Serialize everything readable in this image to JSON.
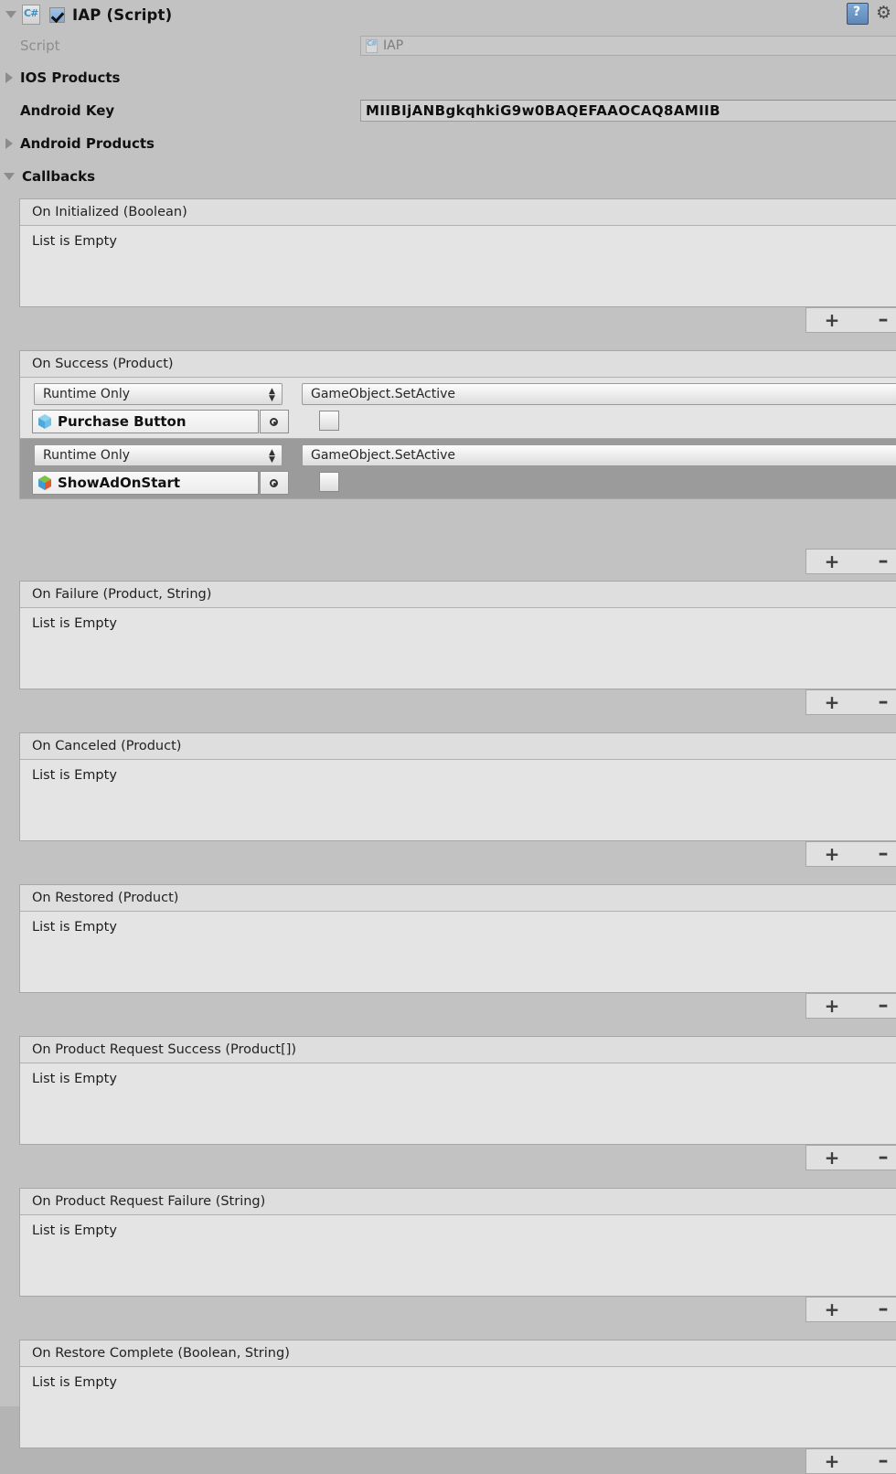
{
  "component": {
    "title": "IAP (Script)",
    "enabled_checkbox": true,
    "foldout_expanded": true,
    "script_icon": "csharp-script-icon",
    "help_icon": "help-book-icon",
    "gear_icon": "gear-icon"
  },
  "properties": [
    {
      "label": "Script",
      "type": "object_field",
      "value": "IAP",
      "disabled": true,
      "icon": "csharp-script-icon"
    },
    {
      "label": "IOS Products",
      "type": "foldout",
      "expanded": false
    },
    {
      "label": "Android Key",
      "type": "text_field",
      "value": "MIIBIjANBgkqhkiG9w0BAQEFAAOCAQ8AMIIB"
    },
    {
      "label": "Android Products",
      "type": "foldout",
      "expanded": false
    },
    {
      "label": "Callbacks",
      "type": "foldout",
      "expanded": true
    }
  ],
  "callbacks": [
    {
      "title": "On Initialized (Boolean)",
      "empty_text": "List is Empty",
      "entries": []
    },
    {
      "title": "On Success (Product)",
      "empty_text": "List is Empty",
      "entries": [
        {
          "mode": "Runtime Only",
          "function": "GameObject.SetActive",
          "target": "Purchase Button",
          "target_icon": "prefab-cube-icon",
          "argument_checked": false,
          "selected": false
        },
        {
          "mode": "Runtime Only",
          "function": "GameObject.SetActive",
          "target": "ShowAdOnStart",
          "target_icon": "gameobject-cube-icon",
          "argument_checked": false,
          "selected": true
        }
      ]
    },
    {
      "title": "On Failure (Product, String)",
      "empty_text": "List is Empty",
      "entries": []
    },
    {
      "title": "On Canceled (Product)",
      "empty_text": "List is Empty",
      "entries": []
    },
    {
      "title": "On Restored (Product)",
      "empty_text": "List is Empty",
      "entries": []
    },
    {
      "title": "On Product Request Success (Product[])",
      "empty_text": "List is Empty",
      "entries": []
    },
    {
      "title": "On Product Request Failure (String)",
      "empty_text": "List is Empty",
      "entries": []
    },
    {
      "title": "On Restore Complete (Boolean, String)",
      "empty_text": "List is Empty",
      "entries": []
    }
  ],
  "footer_buttons": {
    "add_label": "+",
    "remove_label": "–"
  },
  "colors": {
    "window_bg": "#c2c2c2",
    "panel_bg": "#e4e4e4",
    "header_bg": "#dedede",
    "selected_row": "#9b9b9b",
    "border": "#a7a7a7",
    "accent_blue": "#5d87b6",
    "disabled_text": "#8d8d8d"
  }
}
